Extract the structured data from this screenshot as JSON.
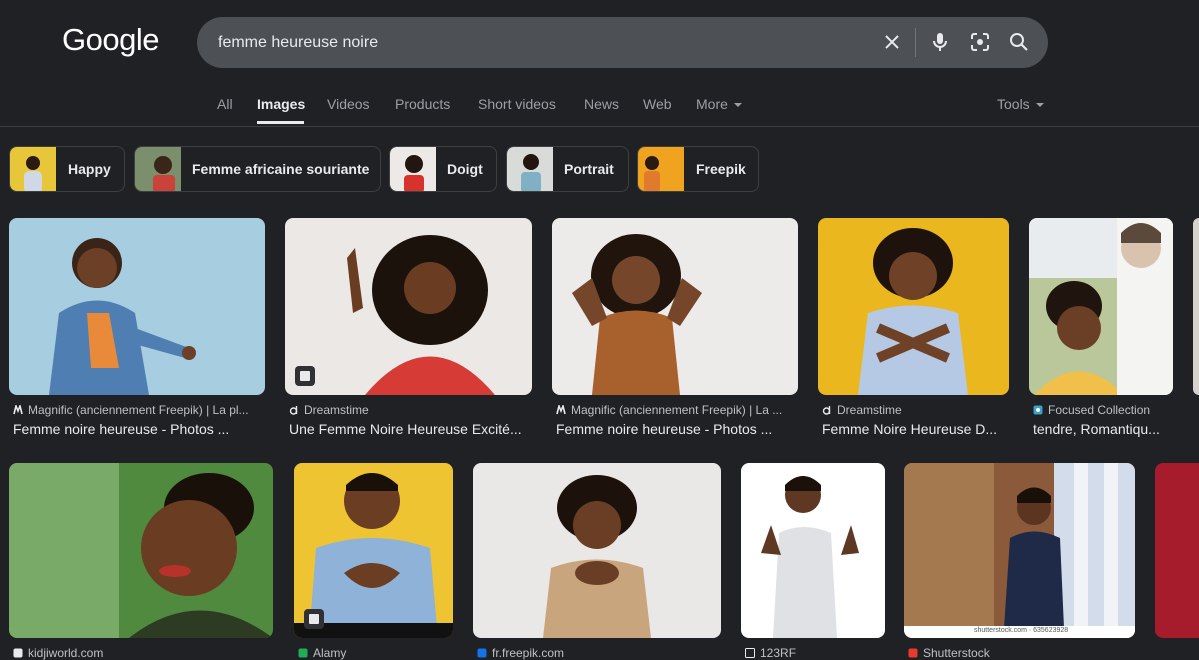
{
  "logo": "Google",
  "search": {
    "query": "femme heureuse noire"
  },
  "tabs": [
    {
      "label": "All"
    },
    {
      "label": "Images"
    },
    {
      "label": "Videos"
    },
    {
      "label": "Products"
    },
    {
      "label": "Short videos"
    },
    {
      "label": "News"
    },
    {
      "label": "Web"
    },
    {
      "label": "More"
    }
  ],
  "tools_label": "Tools",
  "chips": [
    {
      "label": "Happy"
    },
    {
      "label": "Femme africaine souriante"
    },
    {
      "label": "Doigt"
    },
    {
      "label": "Portrait"
    },
    {
      "label": "Freepik"
    }
  ],
  "results_row1": [
    {
      "source": "Magnific (anciennement Freepik) | La pl...",
      "title": "Femme noire heureuse - Photos ..."
    },
    {
      "source": "Dreamstime",
      "title": "Une Femme Noire Heureuse Excité..."
    },
    {
      "source": "Magnific (anciennement Freepik) | La ...",
      "title": "Femme noire heureuse - Photos ..."
    },
    {
      "source": "Dreamstime",
      "title": "Femme Noire Heureuse D..."
    },
    {
      "source": "Focused Collection",
      "title": "tendre, Romantiqu..."
    }
  ],
  "results_row2": [
    {
      "source": "kidjiworld.com"
    },
    {
      "source": "Alamy"
    },
    {
      "source": "fr.freepik.com"
    },
    {
      "source": "123RF"
    },
    {
      "source": "Shutterstock"
    }
  ],
  "watermark_shutterstock": "shutterstock.com · 635623928",
  "colors": {
    "background": "#202124",
    "searchbox": "#4d5156",
    "text": "#e8eaed",
    "muted": "#9aa0a6"
  }
}
